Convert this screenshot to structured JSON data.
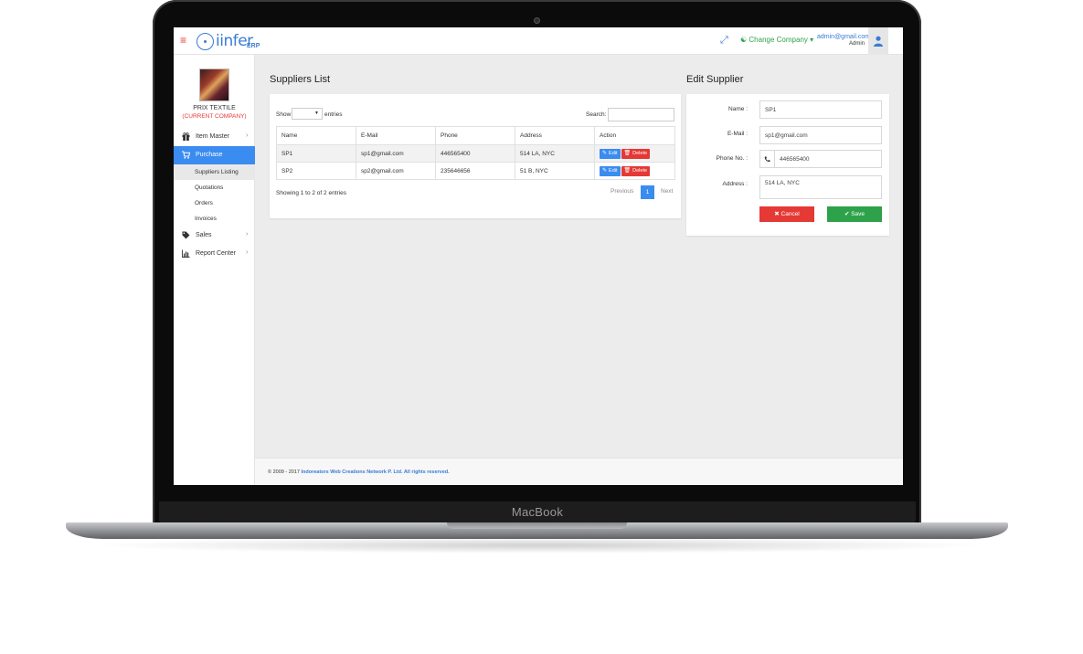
{
  "device": {
    "brand_label": "MacBook"
  },
  "topbar": {
    "logo_text": "iinfer",
    "logo_suffix": "ERP",
    "change_company_label": "Change Company",
    "user_email": "admin@gmail.com",
    "user_role": "Admin"
  },
  "sidebar": {
    "company_name": "PRIX TEXTILE",
    "company_note": "(CURRENT COMPANY)",
    "items": [
      {
        "label": "Item Master",
        "icon": "gift-icon"
      },
      {
        "label": "Purchase",
        "icon": "cart-icon"
      },
      {
        "label": "Sales",
        "icon": "tags-icon"
      },
      {
        "label": "Report Center",
        "icon": "bar-chart-icon"
      }
    ],
    "purchase_subitems": [
      {
        "label": "Suppliers Listing"
      },
      {
        "label": "Quotations"
      },
      {
        "label": "Orders"
      },
      {
        "label": "Invoices"
      }
    ]
  },
  "suppliers_list": {
    "title": "Suppliers List",
    "show_label": "Show",
    "entries_label": "entries",
    "search_label": "Search:",
    "columns": [
      "Name",
      "E-Mail",
      "Phone",
      "Address",
      "Action"
    ],
    "rows": [
      {
        "name": "SP1",
        "email": "sp1@gmail.com",
        "phone": "446565400",
        "address": "514 LA, NYC"
      },
      {
        "name": "SP2",
        "email": "sp2@gmail.com",
        "phone": "235646656",
        "address": "51 B, NYC"
      }
    ],
    "edit_label": "Edit",
    "delete_label": "Delete",
    "showing_text": "Showing 1 to 2 of 2 entries",
    "pagination": {
      "previous": "Previous",
      "current": "1",
      "next": "Next"
    }
  },
  "edit_supplier": {
    "title": "Edit Supplier",
    "name_label": "Name :",
    "name_value": "SP1",
    "email_label": "E-Mail :",
    "email_value": "sp1@gmail.com",
    "phone_label": "Phone No. :",
    "phone_value": "446565400",
    "address_label": "Address :",
    "address_value": "514 LA, NYC",
    "cancel_label": "Cancel",
    "save_label": "Save"
  },
  "footer": {
    "prefix": "© 2009 - 2017",
    "company": "Indoreators Web Creations Network P. Ltd. All rights reserved."
  },
  "colors": {
    "accent_blue": "#3a8cf0",
    "danger_red": "#e53935",
    "success_green": "#2ea24a"
  }
}
